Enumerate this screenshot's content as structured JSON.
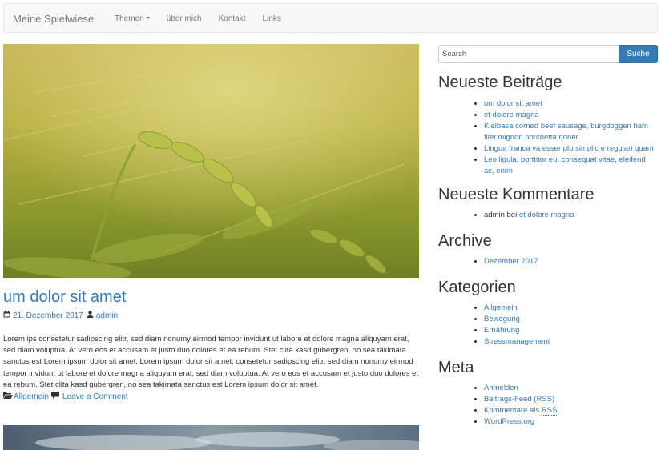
{
  "navbar": {
    "brand": "Meine Spielwiese",
    "items": [
      {
        "label": "Themen"
      },
      {
        "label": "über mich"
      },
      {
        "label": "Kontakt"
      },
      {
        "label": "Links"
      }
    ]
  },
  "post": {
    "title": "um dolor sit amet",
    "date": "21. Dezember 2017",
    "author": "admin",
    "excerpt": "Lorem ips consetetur sadipscing elitr, sed diam nonumy eirmod tempor invidunt ut labore et dolore magna aliquyam erat, sed diam voluptua. At vero eos et accusam et justo duo dolores et ea rebum. Stet clita kasd gubergren, no sea takimata sanctus est Lorem ipsum dolor sit amet. Lorem ipsum dolor sit amet, consetetur sadipscing elitr, sed diam nonumy eirmod tempor invidunt ut labore et dolore magna aliquyam erat, sed diam voluptua. At vero eos et accusam et justo duo dolores et ea rebum. Stet clita kasd gubergren, no sea takimata sanctus est Lorem ipsum dolor sit amet.",
    "category": "Allgemein",
    "comment_link": "Leave a Comment"
  },
  "search": {
    "placeholder": "Search",
    "button": "Suche"
  },
  "sidebar": {
    "recent_posts": {
      "title": "Neueste Beiträge",
      "items": [
        "um dolor sit amet",
        "et dolore magna",
        "Kielbasa corned beef sausage, burgdoggen ham filet mignon porchetta doner",
        "Lingua franca va esser plu simplic e regulari quam",
        "Leo ligula, porttitor eu, consequat vitae, eleifend ac, enim"
      ]
    },
    "recent_comments": {
      "title": "Neueste Kommentare",
      "author": "admin",
      "connector": "bei",
      "post": "et dolore magna"
    },
    "archive": {
      "title": "Archive",
      "items": [
        "Dezember 2017"
      ]
    },
    "categories": {
      "title": "Kategorien",
      "items": [
        "Allgemein",
        "Bewegung",
        "Ernährung",
        "Stressmanagement"
      ]
    },
    "meta": {
      "title": "Meta",
      "login": "Anmelden",
      "entries_feed": "Beitrags-Feed (",
      "comments_feed": "Kommentare als ",
      "rss": "RSS",
      "close_paren": ")",
      "wordpress": "WordPress.org"
    }
  },
  "icons": {
    "calendar": "calendar-icon",
    "user": "user-icon",
    "folder": "folder-open-icon",
    "comment": "comment-icon"
  }
}
